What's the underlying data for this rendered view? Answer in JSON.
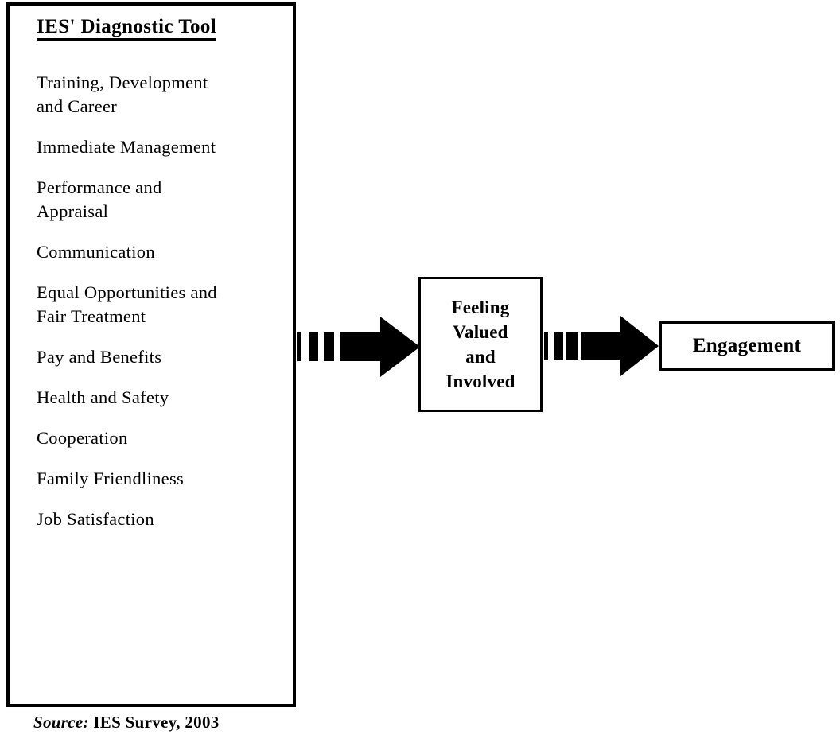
{
  "panel": {
    "title": "IES' Diagnostic Tool",
    "items": [
      "Training, Development\nand Career",
      "Immediate Management",
      "Performance and\nAppraisal",
      "Communication",
      "Equal Opportunities and\nFair Treatment",
      "Pay and Benefits",
      "Health and Safety",
      "Cooperation",
      "Family Friendliness",
      "Job Satisfaction"
    ]
  },
  "nodes": {
    "feeling": "Feeling\nValued\nand\nInvolved",
    "engagement": "Engagement"
  },
  "connectors": {
    "arrow_left": "dashed-block-arrow-right",
    "arrow_right": "dashed-block-arrow-right"
  },
  "source": {
    "label": "Source:",
    "text": "IES Survey, 2003"
  },
  "colors": {
    "ink": "#000000",
    "paper": "#ffffff"
  }
}
